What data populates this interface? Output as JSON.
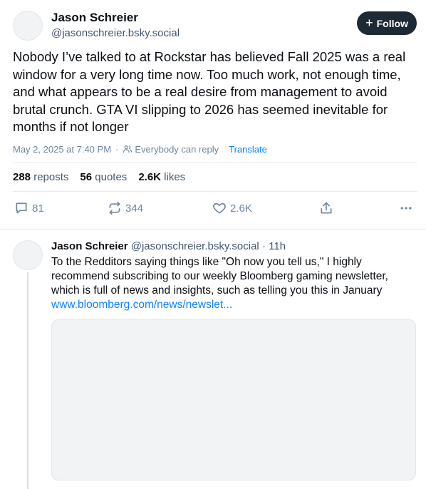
{
  "post": {
    "author_name": "Jason Schreier",
    "author_handle": "@jasonschreier.bsky.social",
    "follow_label": "Follow",
    "text": "Nobody I’ve talked to at Rockstar has believed Fall 2025 was a real window for a very long time now. Too much work, not enough time, and what appears to be a real desire from management to avoid brutal crunch. GTA VI slipping to 2026 has seemed inevitable for months if not longer",
    "timestamp": "May 2, 2025 at 7:40 PM",
    "separator": "·",
    "reply_setting": "Everybody can reply",
    "translate_label": "Translate",
    "stats": {
      "reposts_count": "288",
      "reposts_label": "reposts",
      "quotes_count": "56",
      "quotes_label": "quotes",
      "likes_count": "2.6K",
      "likes_label": "likes"
    },
    "actions": {
      "replies": "81",
      "reposts": "344",
      "likes": "2.6K"
    }
  },
  "reply": {
    "author_name": "Jason Schreier",
    "author_handle": "@jasonschreier.bsky.social",
    "separator": "·",
    "age": "11h",
    "text": "To the Redditors saying things like \"Oh now you tell us,\" I highly recommend subscribing to our weekly Bloomberg gaming newsletter, which is full of news and insights, such as telling you this in January",
    "link_text": "www.bloomberg.com/news/newslet..."
  },
  "icons": {
    "reply": "speech-bubble-icon",
    "repost": "repost-arrows-icon",
    "like": "heart-icon",
    "share": "share-icon",
    "more": "more-dots-icon",
    "reply_setting": "people-icon",
    "follow": "plus-icon"
  },
  "colors": {
    "link": "#1083fe",
    "follow_button": "#1e2936",
    "muted_text": "#6f869f"
  }
}
